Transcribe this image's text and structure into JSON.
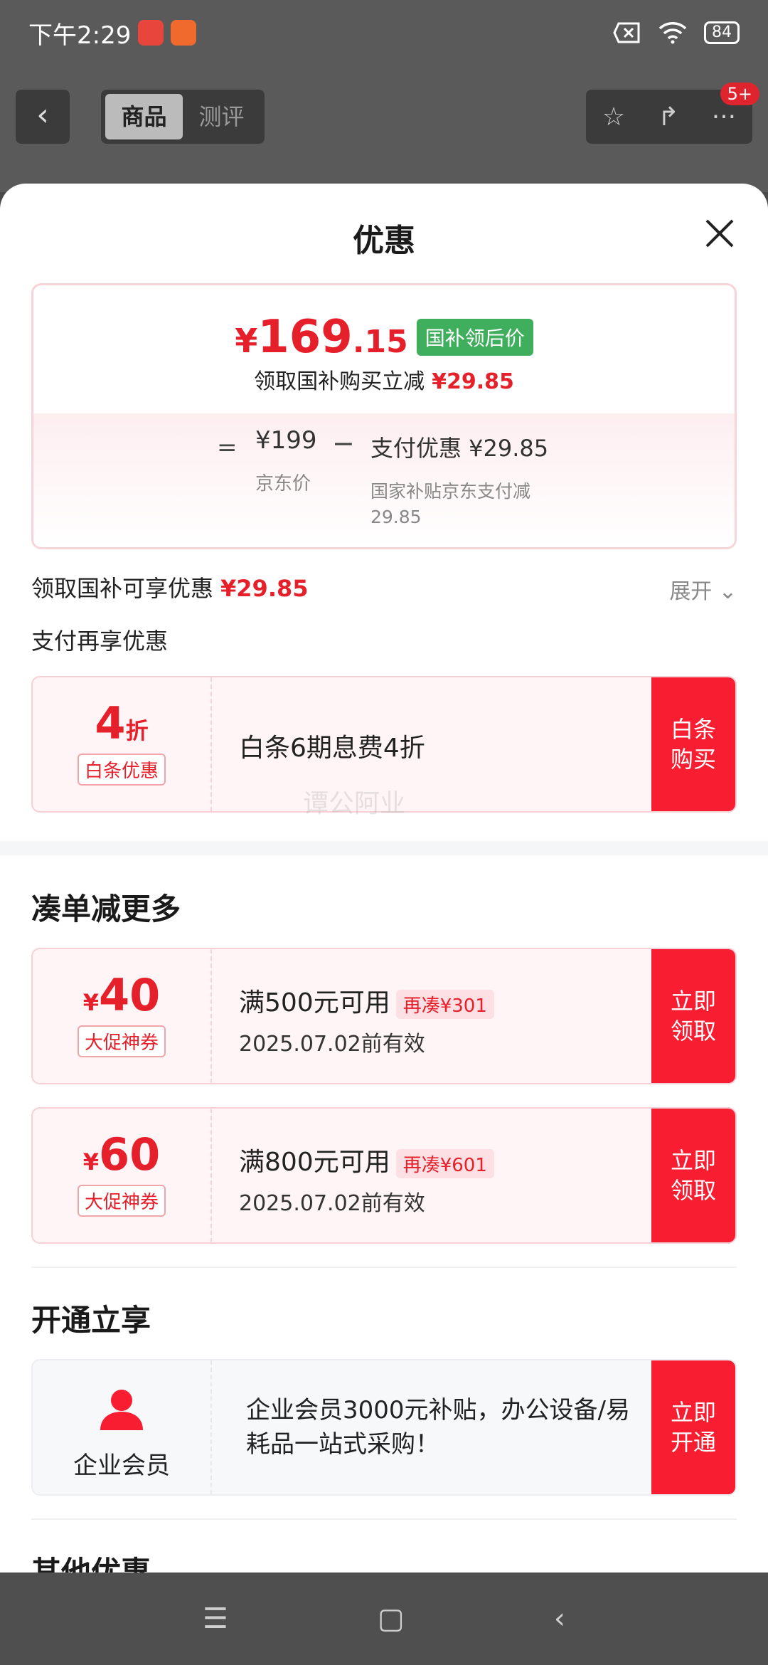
{
  "status_bar": {
    "time": "下午2:29",
    "battery": "84"
  },
  "nav": {
    "tabs": [
      "商品",
      "测评"
    ],
    "badge": "5+"
  },
  "sheet": {
    "title": "优惠",
    "price_card": {
      "yen": "¥",
      "price_int": "169",
      "price_dec": ".15",
      "tag": "国补领后价",
      "sub_text": "领取国补购买立减",
      "sub_amount": "¥29.85",
      "eq": "=",
      "base_price": "¥199",
      "base_caption": "京东价",
      "minus": "−",
      "pay_discount_label": "支付优惠 ¥29.85",
      "pay_discount_sub": "国家补贴京东支付减 29.85"
    },
    "subsidy_row": {
      "label": "领取国补可享优惠",
      "amount": "¥29.85",
      "expand": "展开"
    },
    "pay_more_label": "支付再享优惠",
    "baitiao": {
      "value": "4",
      "unit": "折",
      "tag": "白条优惠",
      "title": "白条6期息费4折",
      "button": "白条\n购买"
    },
    "watermark": "谭公阿业",
    "section_combine": "凑单减更多",
    "coupons": [
      {
        "yen": "¥",
        "value": "40",
        "tag": "大促神券",
        "title": "满500元可用",
        "pill": "再凑¥301",
        "date": "2025.07.02前有效",
        "button": "立即\n领取"
      },
      {
        "yen": "¥",
        "value": "60",
        "tag": "大促神券",
        "title": "满800元可用",
        "pill": "再凑¥601",
        "date": "2025.07.02前有效",
        "button": "立即\n领取"
      }
    ],
    "section_open": "开通立享",
    "enterprise": {
      "label": "企业会员",
      "title": "企业会员3000元补贴，办公设备/易耗品一站式采购！",
      "button": "立即\n开通"
    },
    "section_other": "其他优惠"
  },
  "colors": {
    "accent_red": "#f81d30",
    "price_red": "#e6202b",
    "tag_green": "#3fae5d"
  }
}
